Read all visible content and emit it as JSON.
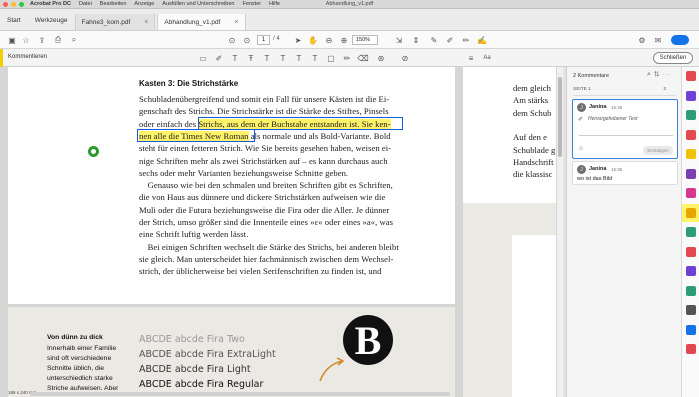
{
  "menubar": {
    "app": "Acrobat Pro DC",
    "items": [
      "Datei",
      "Bearbeiten",
      "Anzeige",
      "Ausfüllen und Unterschreiben",
      "Fenster",
      "Hilfe"
    ],
    "doc_title": "Abhandlung_v1.pdf"
  },
  "tabs": {
    "home": "Start",
    "tools": "Werkzeuge",
    "files": [
      {
        "label": "Fahne3_kom.pdf",
        "active": false
      },
      {
        "label": "Abhandlung_v1.pdf",
        "active": true
      }
    ]
  },
  "toolbar": {
    "page_current": "1",
    "page_total": "/ 4",
    "zoom": "150%"
  },
  "comment_toolbar": {
    "label": "Kommentieren",
    "close_label": "Schließen",
    "highlight_color": "#ffe95a"
  },
  "document": {
    "box_title": "Kasten 3: Die Strichstärke",
    "lines": [
      {
        "parts": [
          {
            "t": "Schubladenübergreifend und somit ein Fall für unsere Kästen ist die Ei-",
            "h": false
          }
        ]
      },
      {
        "parts": [
          {
            "t": "genschaft des Strichs. Die Strichstärke ist die Stärke des Stiftes, Pinsels",
            "h": false
          }
        ]
      },
      {
        "parts": [
          {
            "t": "oder einfach des ",
            "h": false
          },
          {
            "t": "Strichs, aus dem der Buchstabe entstanden ist. Sie ken-",
            "h": true
          }
        ]
      },
      {
        "parts": [
          {
            "t": "nen alle die Times New Roman",
            "h": true
          },
          {
            "t": " als normale und als Bold-Variante. Bold",
            "h": false
          }
        ]
      },
      {
        "parts": [
          {
            "t": "steht für einen fetteren Strich. Wie Sie bereits gesehen haben, weisen ei-",
            "h": false
          }
        ]
      },
      {
        "parts": [
          {
            "t": "nige Schriften mehr als zwei Strichstärken auf – es kann durchaus auch",
            "h": false
          }
        ]
      },
      {
        "parts": [
          {
            "t": "sechs oder mehr Varianten beziehungsweise Schnitte geben.",
            "h": false
          }
        ]
      },
      {
        "parts": [
          {
            "t": "    Genauso wie bei den schmalen und breiten Schriften gibt es Schriften,",
            "h": false
          }
        ]
      },
      {
        "parts": [
          {
            "t": "die von Haus aus dünnere und dickere Strichstärken aufweisen wie die",
            "h": false
          }
        ]
      },
      {
        "parts": [
          {
            "t": "Muli oder die Futura beziehungsweise die Fira oder die Aller. Je dünner",
            "h": false
          }
        ]
      },
      {
        "parts": [
          {
            "t": "der Strich, umso größer sind die Innenteile eines »ε« oder eines »a«, was",
            "h": false
          }
        ]
      },
      {
        "parts": [
          {
            "t": "eine Schrift luftig werden lässt.",
            "h": false
          }
        ]
      },
      {
        "parts": [
          {
            "t": "    Bei einigen Schriften wechselt die Stärke des Strichs, bei anderen bleibt",
            "h": false
          }
        ]
      },
      {
        "parts": [
          {
            "t": "sie gleich. Man unterscheidet hier fachmännisch zwischen dem Wechsel-",
            "h": false
          }
        ]
      },
      {
        "parts": [
          {
            "t": "strich, der üblicherweise bei vielen Serifenschriften zu finden ist, und",
            "h": false
          }
        ]
      }
    ],
    "right_page_lines": [
      "dem gleich",
      "Am stärks",
      "dem Schub",
      "",
      "Auf den e",
      "Schublade g",
      "Handschrift",
      "die klassisc"
    ],
    "lower": {
      "heading": "Von dünn zu dick",
      "body": [
        "Innerhalb einer Familie",
        "sind oft verschiedene",
        "Schnitte üblich, die",
        "unterschiedlich starke",
        "Striche aufweisen. Aber"
      ],
      "samples": [
        "ABCDE abcde Fira Two",
        "ABCDE abcde Fira ExtraLight",
        "ABCDE abcde Fira Light",
        "ABCDE abcde Fira Regular"
      ],
      "big_letter": "B"
    },
    "page_size": "186 x 240 mm"
  },
  "comments_panel": {
    "header": "2 Kommentare",
    "section": "SEITE 1",
    "section_count": "2",
    "comments": [
      {
        "author": "Janina",
        "time": "15:35",
        "subtitle": "Hervorgehobener Text",
        "button": "Bestätigen",
        "initial": "J"
      },
      {
        "author": "Janina",
        "time": "15:35",
        "text": "wo ist das Bild",
        "initial": "J"
      }
    ]
  },
  "rail_colors": [
    "#e34850",
    "#6f3fd6",
    "#2d9d78",
    "#e34850",
    "#f2c200",
    "#7a3fb5",
    "#d83790",
    "#1473e6",
    "#2d9d78",
    "#e34850",
    "#6f3fd6",
    "#2d9d78",
    "#555555",
    "#1473e6",
    "#e34850"
  ]
}
